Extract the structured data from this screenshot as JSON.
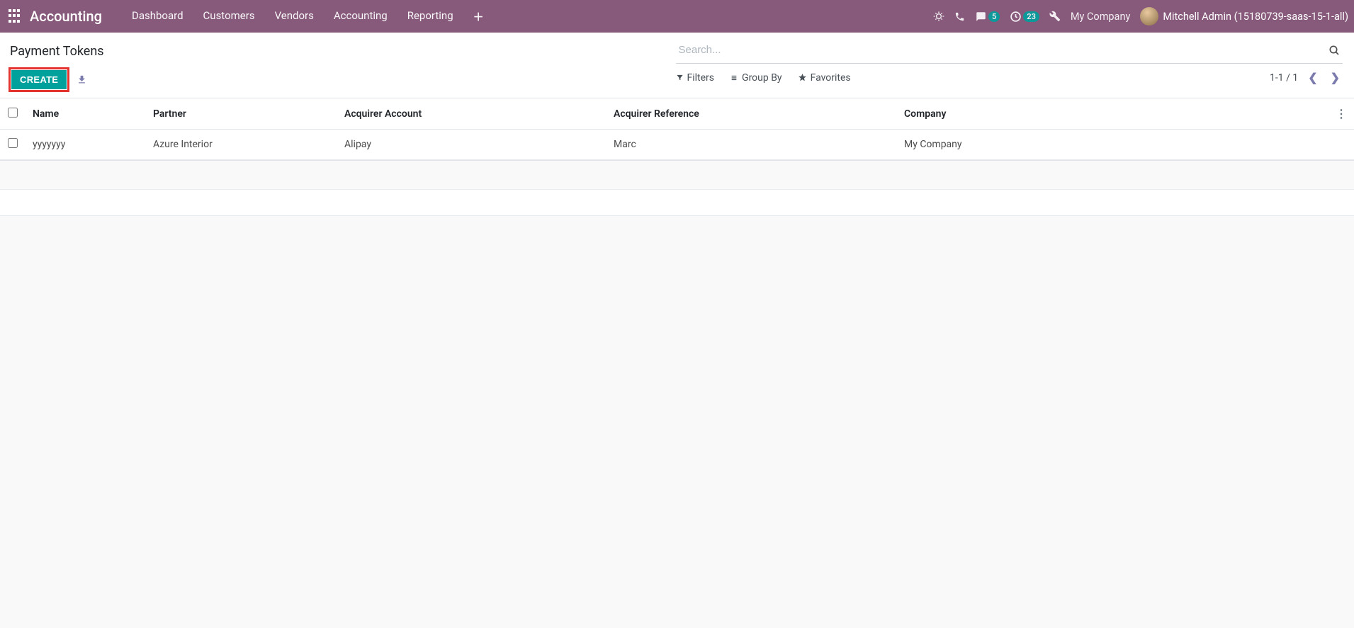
{
  "topnav": {
    "brand": "Accounting",
    "links": [
      "Dashboard",
      "Customers",
      "Vendors",
      "Accounting",
      "Reporting"
    ],
    "messages_badge": "5",
    "activities_badge": "23",
    "company": "My Company",
    "user": "Mitchell Admin (15180739-saas-15-1-all)"
  },
  "page": {
    "title": "Payment Tokens",
    "create_label": "CREATE"
  },
  "search": {
    "placeholder": "Search...",
    "filters_label": "Filters",
    "groupby_label": "Group By",
    "favorites_label": "Favorites",
    "pager_text": "1-1 / 1"
  },
  "table": {
    "headers": {
      "name": "Name",
      "partner": "Partner",
      "acquirer_account": "Acquirer Account",
      "acquirer_reference": "Acquirer Reference",
      "company": "Company"
    },
    "rows": [
      {
        "name": "yyyyyyy",
        "partner": "Azure Interior",
        "acquirer_account": "Alipay",
        "acquirer_reference": "Marc",
        "company": "My Company"
      }
    ]
  }
}
